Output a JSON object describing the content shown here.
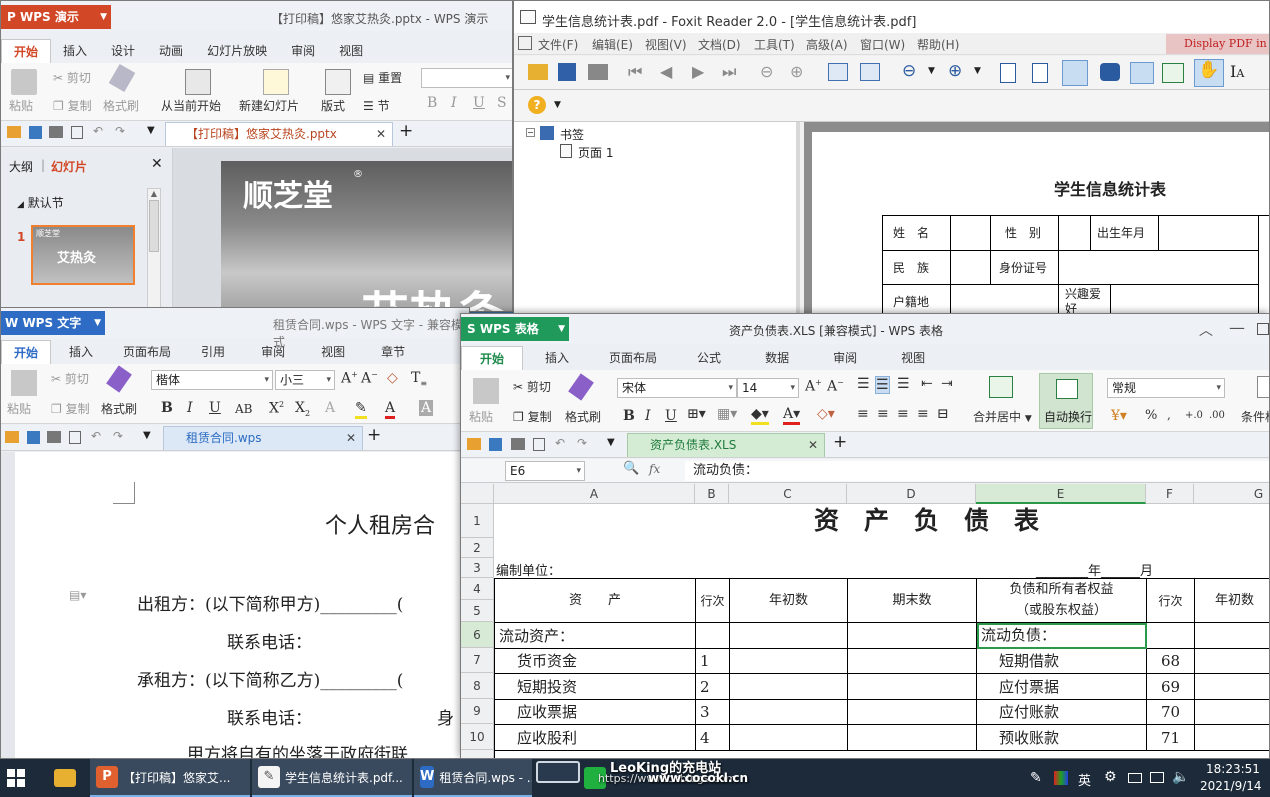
{
  "wps_ppt": {
    "brand": "WPS 演示",
    "title": "【打印稿】悠家艾热灸.pptx - WPS 演示",
    "tabs": [
      "开始",
      "插入",
      "设计",
      "动画",
      "幻灯片放映",
      "审阅",
      "视图"
    ],
    "tools": {
      "paste": "粘贴",
      "cut": "剪切",
      "copy": "复制",
      "format_painter": "格式刷",
      "from_current": "从当前开始",
      "new_slide": "新建幻灯片",
      "layout": "版式",
      "reset": "重置",
      "section": "节"
    },
    "doc_tab": "【打印稿】悠家艾热灸.pptx",
    "panel_tabs": {
      "outline": "大纲",
      "slides": "幻灯片"
    },
    "default_section": "默认节",
    "slide_num": "1",
    "thumb_brand": "顺芝堂",
    "thumb_text": "艾热灸",
    "slide_brand": "顺芝堂",
    "slide_reg": "®",
    "slide_big": "艾热灸"
  },
  "foxit": {
    "title": "学生信息统计表.pdf - Foxit Reader 2.0 - [学生信息统计表.pdf]",
    "menu": [
      "文件(F)",
      "编辑(E)",
      "视图(V)",
      "文档(D)",
      "工具(T)",
      "高级(A)",
      "窗口(W)",
      "帮助(H)"
    ],
    "promo": "Display PDF in y",
    "bookmark_root": "书签",
    "bookmark_page": "页面 1",
    "doc_title": "学生信息统计表",
    "table": {
      "r1": [
        "姓　名",
        "",
        "性　别",
        "",
        "出生年月",
        ""
      ],
      "r2": [
        "民　族",
        "",
        "身份证号",
        ""
      ],
      "r3": [
        "户籍地",
        "",
        "兴趣爱好",
        ""
      ]
    }
  },
  "wps_writer": {
    "brand": "WPS 文字",
    "title": "租赁合同.wps - WPS 文字 - 兼容模式",
    "tabs": [
      "开始",
      "插入",
      "页面布局",
      "引用",
      "审阅",
      "视图",
      "章节"
    ],
    "tools": {
      "paste": "粘贴",
      "cut": "剪切",
      "copy": "复制",
      "format_painter": "格式刷"
    },
    "font": "楷体",
    "size": "小三",
    "doc_tab": "租赁合同.wps",
    "doc_title": "个人租房合",
    "lines": [
      "出租方：(以下简称甲方)_________(",
      "联系电话：",
      "承租方：(以下简称乙方)_________(",
      "联系电话：",
      "身",
      "甲方将自有的坐落于政府街联"
    ]
  },
  "wps_sheet": {
    "brand": "WPS 表格",
    "title": "资产负债表.XLS [兼容模式] - WPS 表格",
    "tabs": [
      "开始",
      "插入",
      "页面布局",
      "公式",
      "数据",
      "审阅",
      "视图"
    ],
    "tools": {
      "paste": "粘贴",
      "cut": "剪切",
      "copy": "复制",
      "format_painter": "格式刷",
      "merge": "合并居中",
      "wrap": "自动换行",
      "number_format": "常规",
      "percent": "%",
      "cond": "条件格"
    },
    "font": "宋体",
    "size": "14",
    "doc_tab": "资产负债表.XLS",
    "name_box": "E6",
    "fx": "fx",
    "formula": "流动负债：",
    "cols": [
      "A",
      "B",
      "C",
      "D",
      "E",
      "F",
      "G"
    ],
    "rows": [
      "1",
      "2",
      "3",
      "4",
      "5",
      "6",
      "7",
      "8",
      "9",
      "10"
    ],
    "sheet_title": "资　产　负　债　表",
    "unit_label": "编制单位：",
    "date_label": "________年______月",
    "hdr": {
      "assets": "资　　产",
      "rownum": "行次",
      "begin": "年初数",
      "end": "期末数",
      "liab1": "负债和所有者权益",
      "liab2": "（或股东权益）",
      "rownum2": "行次",
      "begin2": "年初数"
    },
    "r6": {
      "a": "流动资产：",
      "e": "流动负债："
    },
    "data_rows": [
      {
        "a": "货币资金",
        "b": "1",
        "e": "短期借款",
        "f": "68"
      },
      {
        "a": "短期投资",
        "b": "2",
        "e": "应付票据",
        "f": "69"
      },
      {
        "a": "应收票据",
        "b": "3",
        "e": "应付账款",
        "f": "70"
      },
      {
        "a": "应收股利",
        "b": "4",
        "e": "预收账款",
        "f": "71"
      }
    ]
  },
  "taskbar": {
    "items": [
      "【打印稿】悠家艾...",
      "学生信息统计表.pdf...",
      "租赁合同.wps - ..."
    ],
    "watermark1": "LeoKing的充电站",
    "watermark2": "https://www.cnblogs.com",
    "watermark3": "www.cocokl.cn",
    "lang": "英",
    "time": "18:23:51",
    "date": "2021/9/14"
  }
}
